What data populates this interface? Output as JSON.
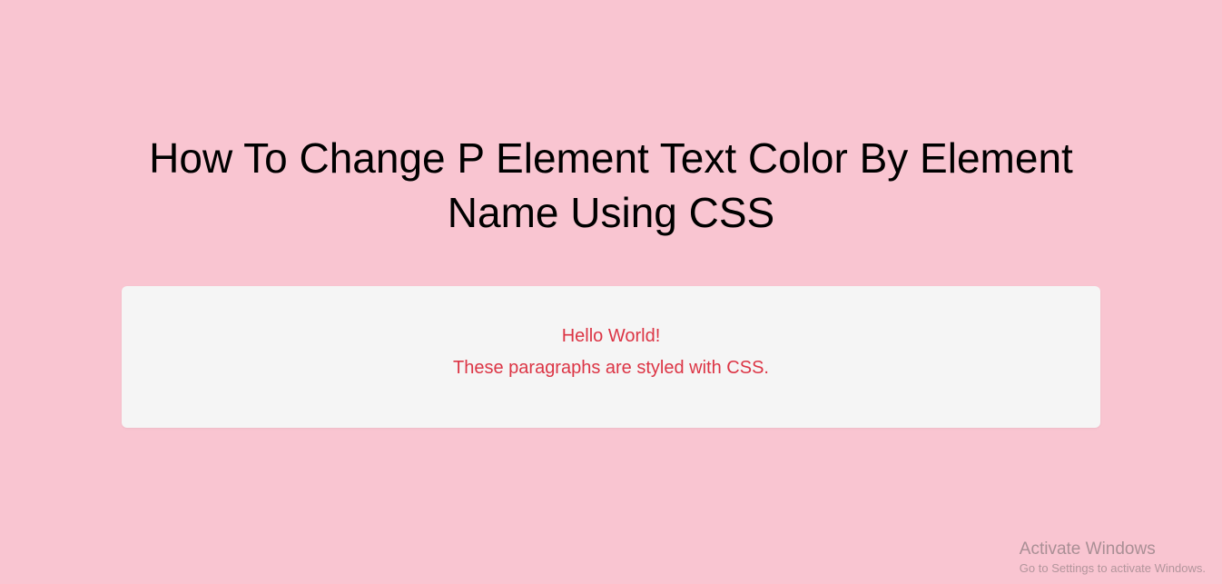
{
  "page": {
    "heading": "How To Change P Element Text Color By Element Name Using CSS"
  },
  "panel": {
    "paragraphs": {
      "p0": "Hello World!",
      "p1": "These paragraphs are styled with CSS."
    }
  },
  "watermark": {
    "title": "Activate Windows",
    "subtitle": "Go to Settings to activate Windows."
  }
}
